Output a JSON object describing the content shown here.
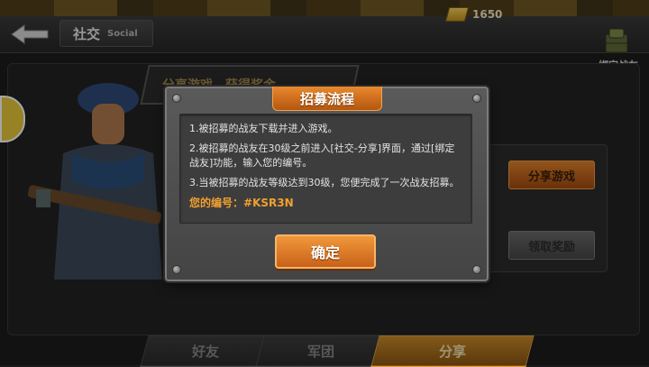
{
  "header": {
    "title_zh": "社交",
    "title_en": "Social",
    "back_icon": "back-arrow-icon"
  },
  "currency": {
    "icon": "gold-bar-icon",
    "amount": "1650"
  },
  "binding": {
    "icon": "binding-crate-icon",
    "label": "绑定战友"
  },
  "background": {
    "banner_text": "分享游戏，获得奖金",
    "share_game_label": "分享游戏",
    "claim_reward_label": "领取奖励"
  },
  "tabs": [
    {
      "label": "好友",
      "active": false
    },
    {
      "label": "军团",
      "active": false
    },
    {
      "label": "分享",
      "active": true
    }
  ],
  "dialog": {
    "title": "招募流程",
    "steps": [
      "1.被招募的战友下载并进入游戏。",
      "2.被招募的战友在30级之前进入[社交-分享]界面，通过[绑定战友]功能，输入您的编号。",
      "3.当被招募的战友等级达到30级，您便完成了一次战友招募。"
    ],
    "code_label": "您的编号：",
    "code_value": "#KSR3N",
    "confirm_label": "确定"
  },
  "colors": {
    "accent_orange": "#e9892e",
    "code_color": "#f0a030"
  }
}
